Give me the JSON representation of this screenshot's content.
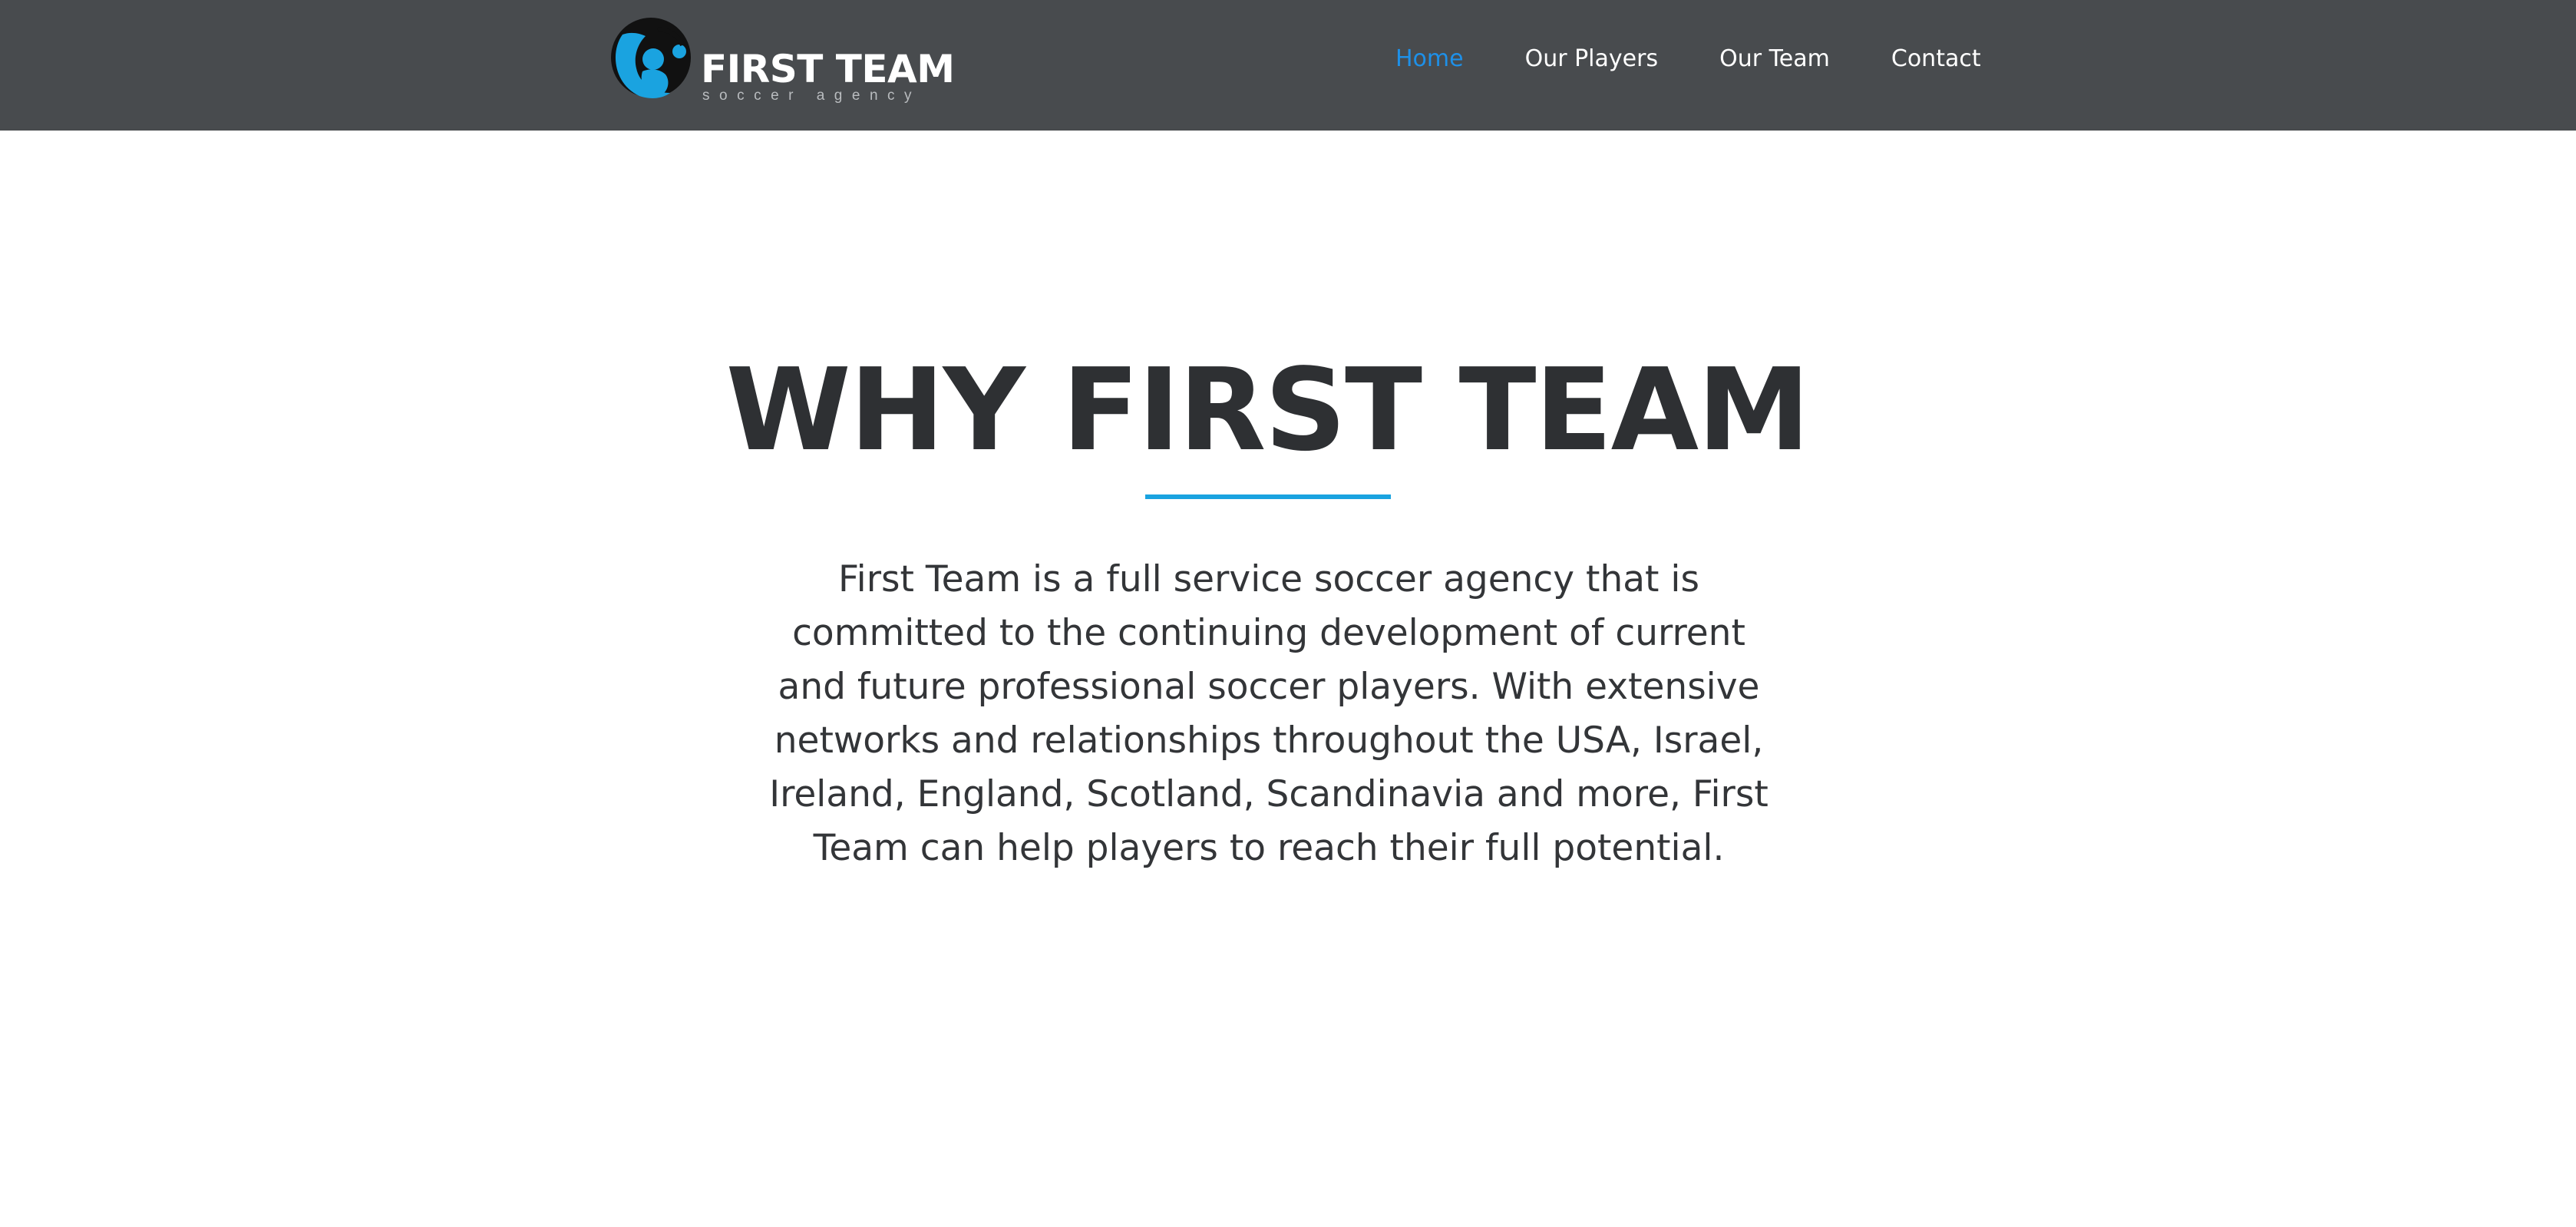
{
  "header": {
    "logo": {
      "title": "FIRST TEAM",
      "subtitle": "soccer agency",
      "colors": {
        "ring": "#1aa3e0",
        "dark": "#111111"
      }
    },
    "nav": [
      {
        "label": "Home",
        "active": true
      },
      {
        "label": "Our Players",
        "active": false
      },
      {
        "label": "Our Team",
        "active": false
      },
      {
        "label": "Contact",
        "active": false
      }
    ]
  },
  "hero": {
    "title": "WHY FIRST TEAM",
    "lines": [
      "First Team is a full service soccer agency that is",
      "committed to the continuing  development of current",
      "and future professional soccer players.  With extensive",
      "networks and relationships throughout the USA, Israel,",
      "Ireland, England, Scotland, Scandinavia and more, First",
      "Team can help players to reach their full potential."
    ]
  },
  "colors": {
    "header_bg": "#484b4e",
    "accent": "#1aa3e0",
    "nav_active": "#1e90e8",
    "text_dark": "#2e3033"
  }
}
